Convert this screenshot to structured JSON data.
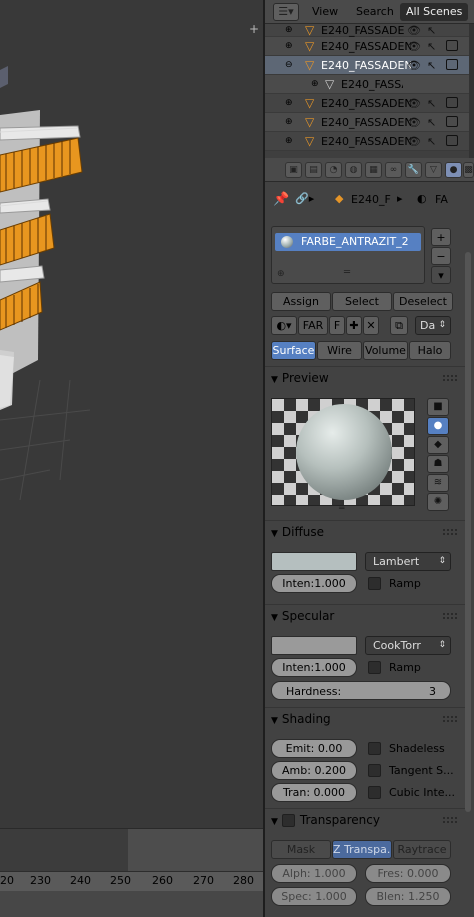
{
  "outliner": {
    "view_label": "View",
    "search_label": "Search",
    "scenes_label": "All Scenes",
    "rows": [
      {
        "name": "E240_FASSADE",
        "selected": false
      },
      {
        "name": "E240_FASSADEN",
        "selected": false
      },
      {
        "name": "E240_FASSADEN",
        "selected": true
      },
      {
        "name": "E240_FASSA",
        "selected": false,
        "child": true
      },
      {
        "name": "E240_FASSADEN",
        "selected": false
      },
      {
        "name": "E240_FASSADEN",
        "selected": false
      },
      {
        "name": "E240_FASSADEN",
        "selected": false
      }
    ]
  },
  "context": {
    "object_name": "E240_F",
    "material_short": "FA"
  },
  "material": {
    "slot_name": "FARBE_ANTRAZIT_2",
    "assign_label": "Assign",
    "select_label": "Select",
    "deselect_label": "Deselect",
    "datablock_name": "FAR",
    "datablock_users": "F",
    "data_dropdown": "Da",
    "type_tabs": [
      "Surface",
      "Wire",
      "Volume",
      "Halo"
    ],
    "active_type": "Surface"
  },
  "preview": {
    "title": "Preview"
  },
  "diffuse": {
    "title": "Diffuse",
    "shader": "Lambert",
    "intensity": "Inten:1.000",
    "ramp_label": "Ramp",
    "color": "#b5bfbf"
  },
  "specular": {
    "title": "Specular",
    "shader": "CookTorr",
    "intensity": "Inten:1.000",
    "ramp_label": "Ramp",
    "hardness_label": "Hardness:",
    "hardness_value": "3"
  },
  "shading": {
    "title": "Shading",
    "emit": "Emit:  0.00",
    "amb": "Amb: 0.200",
    "tran": "Tran: 0.000",
    "shadeless_label": "Shadeless",
    "tangent_label": "Tangent S...",
    "cubic_label": "Cubic Inte..."
  },
  "transparency": {
    "title": "Transparency",
    "modes": [
      "Mask",
      "Z Transpa...",
      "Raytrace"
    ],
    "active_mode": "Z Transpa...",
    "alpha": "Alph: 1.000",
    "fresnel": "Fres: 0.000",
    "spec": "Spec: 1.000",
    "blend": "Blen: 1.250"
  },
  "timeline": {
    "ticks": [
      "20",
      "230",
      "240",
      "250",
      "260",
      "270",
      "280"
    ]
  },
  "colors": {
    "accent_blue": "#5680c2",
    "object_orange": "#e59528"
  }
}
